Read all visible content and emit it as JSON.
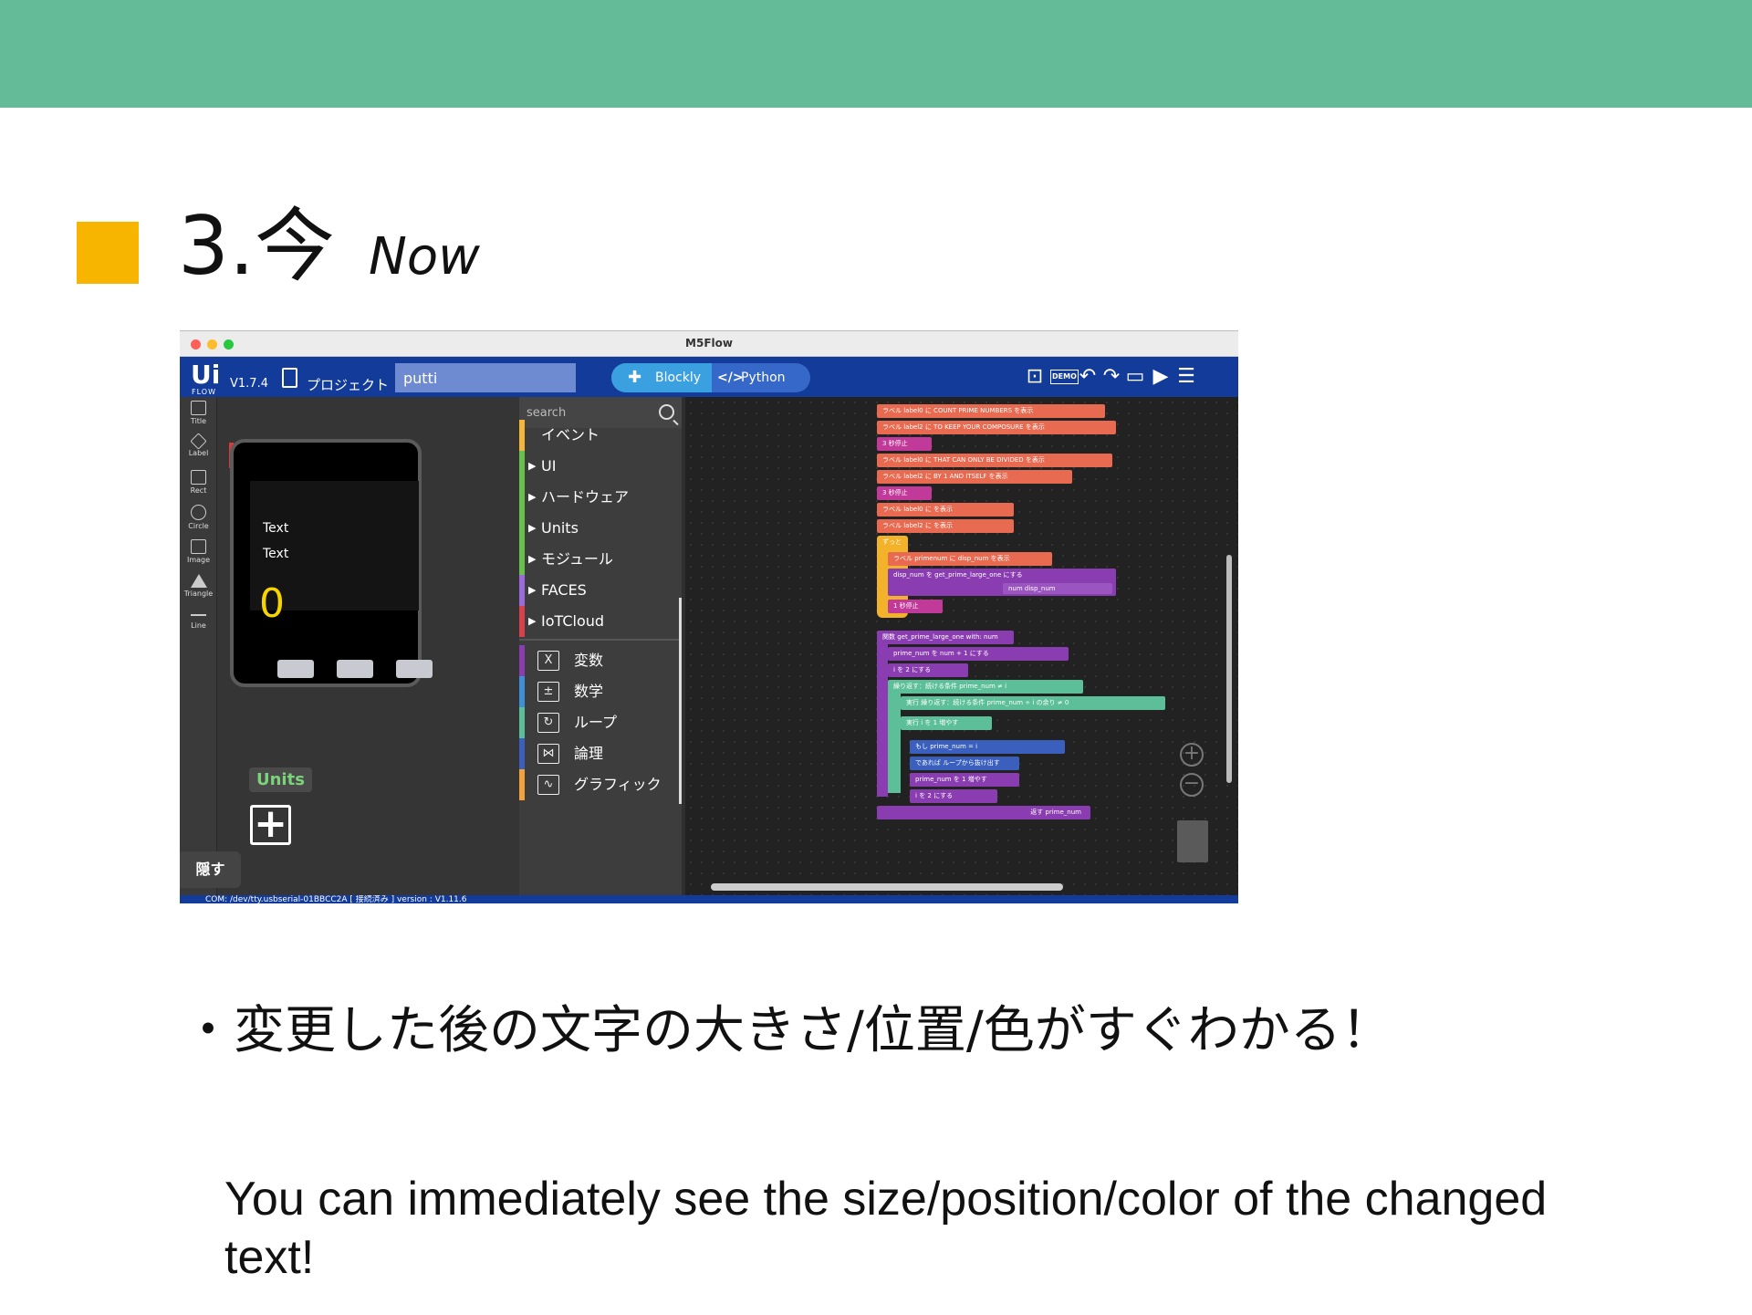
{
  "slide": {
    "title_number": "3.今",
    "title_english": "Now",
    "bullet_marker": "・",
    "bullet_jp": "変更した後の文字の大きさ/位置/色がすぐわかる！",
    "bullet_en": "You can immediately see the size/position/color of the changed text!",
    "colors": {
      "header": "#64bb98",
      "square": "#f7b500"
    }
  },
  "app": {
    "window_title": "M5Flow",
    "logo": "Ui",
    "logo_sub": "FLOW",
    "version": "V1.7.4",
    "project_label": "プロジェクト",
    "project_name": "putti",
    "mode_blockly": "Blockly",
    "mode_python": "Python",
    "toolbar_icons": [
      "new-file-icon",
      "demo-icon",
      "undo-icon",
      "redo-icon",
      "device-icon",
      "run-icon",
      "menu-icon"
    ],
    "demo_label": "DEMO"
  },
  "tools": [
    {
      "name": "Title",
      "icon": "title-icon"
    },
    {
      "name": "Label",
      "icon": "label-icon"
    },
    {
      "name": "Rect",
      "icon": "rect-icon"
    },
    {
      "name": "Circle",
      "icon": "circle-icon"
    },
    {
      "name": "Image",
      "icon": "image-icon"
    },
    {
      "name": "Triangle",
      "icon": "triangle-icon"
    },
    {
      "name": "Line",
      "icon": "line-icon"
    }
  ],
  "device": {
    "text1": "Text",
    "text2": "Text",
    "value": "0"
  },
  "units": {
    "label": "Units",
    "add": "+"
  },
  "hide_button": "隠す",
  "search_placeholder": "search",
  "categories": [
    {
      "label": "イベント",
      "color": "#f5b53a",
      "arrow": ""
    },
    {
      "label": "UI",
      "color": "#68c14a",
      "arrow": "▶"
    },
    {
      "label": "ハードウェア",
      "color": "#68c14a",
      "arrow": "▶"
    },
    {
      "label": "Units",
      "color": "#68c14a",
      "arrow": "▶"
    },
    {
      "label": "モジュール",
      "color": "#68c14a",
      "arrow": "▶"
    },
    {
      "label": "FACES",
      "color": "#9b6bdc",
      "arrow": "▶"
    },
    {
      "label": "IoTCloud",
      "color": "#d8404a",
      "arrow": "▶"
    }
  ],
  "categories2": [
    {
      "label": "変数",
      "color": "#8a3db0",
      "icon": "X"
    },
    {
      "label": "数学",
      "color": "#3f8ed8",
      "icon": "±"
    },
    {
      "label": "ループ",
      "color": "#5cbf9a",
      "icon": "↻"
    },
    {
      "label": "論理",
      "color": "#3a5fbd",
      "icon": "⋈"
    },
    {
      "label": "グラフィック",
      "color": "#f2a23a",
      "icon": "∿"
    }
  ],
  "blocks_text": {
    "b1": "ラベル label0 に COUNT PRIME NUMBERS を表示",
    "b2": "ラベル label2 に TO KEEP YOUR COMPOSURE を表示",
    "b3": "3 秒停止",
    "b4": "ラベル label0 に THAT CAN ONLY BE DIVIDED を表示",
    "b5": "ラベル label2 に BY 1 AND ITSELF を表示",
    "b6": "3 秒停止",
    "b7": "ラベル label0 に を表示",
    "b8": "ラベル label2 に を表示",
    "b9": "ずっと",
    "b10": "ラベル primenum に disp_num を表示",
    "b11": "disp_num を get_prime_large_one にする",
    "b12": "num disp_num",
    "b13": "1 秒停止",
    "f1": "関数 get_prime_large_one with: num",
    "f2": "prime_num を num + 1 にする",
    "f3": "i を 2 にする",
    "f4": "繰り返す：続ける条件 prime_num ≠ i",
    "f5": "実行 繰り返す：続ける条件 prime_num ÷ i の余り ≠ 0",
    "f6": "実行 i を 1 増やす",
    "f7": "もし prime_num = i",
    "f8": "であれば ループから抜け出す",
    "f9": "prime_num を 1 増やす",
    "f10": "i を 2 にする",
    "f11": "返す prime_num"
  },
  "status": "COM: /dev/tty.usbserial-01BBCC2A  [ 接続済み ]  version : V1.11.6"
}
